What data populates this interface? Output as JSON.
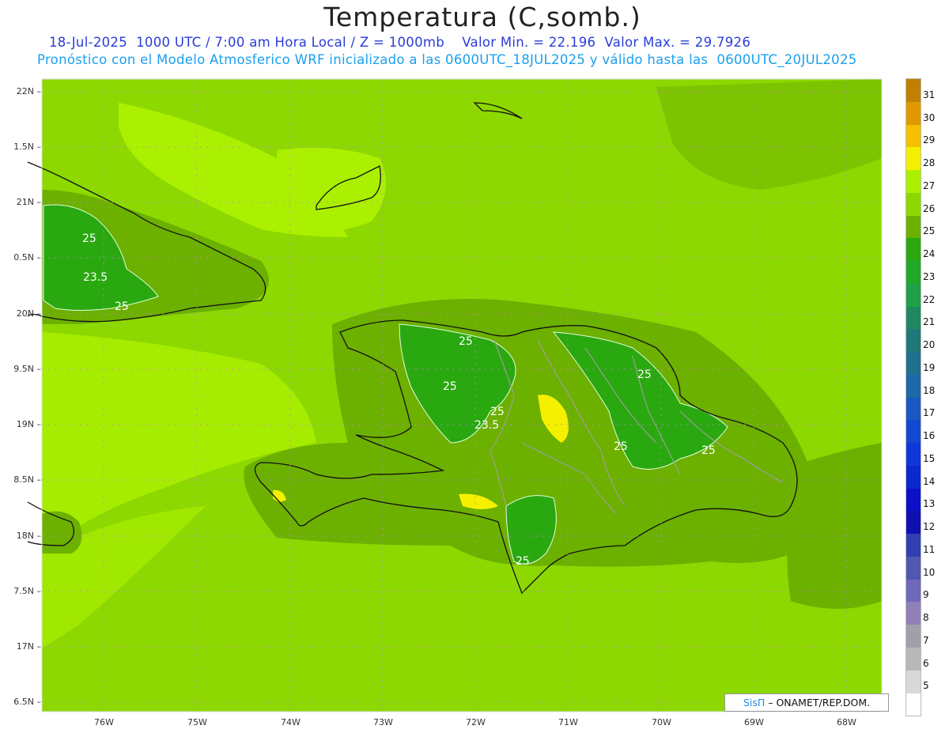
{
  "header": {
    "title": "Temperatura (C,somb.)",
    "line1": "18-Jul-2025  1000 UTC / 7:00 am Hora Local / Z = 1000mb    Valor Min. = 22.196  Valor Max. = 29.7926",
    "line2": "Pronóstico con el Modelo Atmosferico WRF inicializado a las 0600UTC_18JUL2025 y válido hasta las  0600UTC_20JUL2025"
  },
  "axes": {
    "lat_labels": [
      "22N",
      "1.5N",
      "21N",
      "0.5N",
      "20N",
      "9.5N",
      "19N",
      "8.5N",
      "18N",
      "7.5N",
      "17N",
      "6.5N"
    ],
    "lon_labels": [
      "76W",
      "75W",
      "74W",
      "73W",
      "72W",
      "71W",
      "70W",
      "69W",
      "68W"
    ]
  },
  "colorbar": {
    "labels": [
      "31",
      "30",
      "29",
      "28",
      "27",
      "26",
      "25",
      "24",
      "23",
      "22",
      "21",
      "20",
      "19",
      "18",
      "17",
      "16",
      "15",
      "14",
      "13",
      "12",
      "11",
      "10",
      "9",
      "8",
      "7",
      "6",
      "5"
    ],
    "colors": [
      "#c08000",
      "#e09a00",
      "#f5c000",
      "#f5f000",
      "#aaf000",
      "#8cd800",
      "#6cb000",
      "#2aa810",
      "#20a828",
      "#20a048",
      "#208860",
      "#207878",
      "#207090",
      "#1c68a8",
      "#1858c0",
      "#1448d0",
      "#1038d8",
      "#0c28d0",
      "#0c10c8",
      "#1010b0",
      "#3040b0",
      "#5058b0",
      "#7068b8",
      "#9080b8",
      "#a0a0a8",
      "#b8b8b8",
      "#d8d8d8"
    ]
  },
  "contour_labels": [
    "25",
    "23.5",
    "25",
    "25",
    "25",
    "25",
    "23.5",
    "25",
    "25",
    "25",
    "25"
  ],
  "credit": {
    "logo": "SisΠ",
    "text": "– ONAMET/REP.DOM."
  },
  "colors": {
    "ocean_main": "#8cd800",
    "warm_band": "#aaf000",
    "land_cool": "#6cb000",
    "land_cold": "#2aa810",
    "hot_spot": "#f5f000",
    "grid": "#bb88cc"
  }
}
